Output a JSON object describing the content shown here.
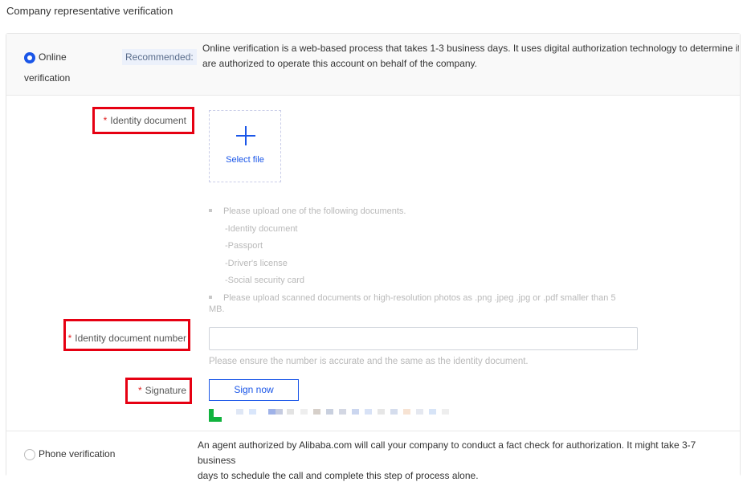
{
  "page": {
    "title": "Company representative verification"
  },
  "online": {
    "label_line1": "Online",
    "label_line2": "verification",
    "badge": "Recommended:",
    "desc_line1": "Online verification is a web-based process that takes 1-3 business days. It uses digital authorization technology to determine if you",
    "desc_line2": "are authorized to operate this account on behalf of the company."
  },
  "identity_doc": {
    "required_mark": "*",
    "label": "Identity document",
    "upload_label": "Select file",
    "hint_intro": "Please upload one of the following documents.",
    "doc_types": [
      "-Identity document",
      "-Passport",
      "-Driver's license",
      "-Social security card"
    ],
    "hint_format_line1": "Please upload scanned documents or high-resolution photos as .png .jpeg .jpg or .pdf smaller than 5",
    "hint_format_line2": "MB."
  },
  "id_number": {
    "required_mark": "*",
    "label": "Identity document number",
    "value": "",
    "hint": "Please ensure the number is accurate and the same as the identity document."
  },
  "signature": {
    "required_mark": "*",
    "label": "Signature",
    "button_label": "Sign now"
  },
  "phone": {
    "label": "Phone verification",
    "desc_line1": "An agent authorized by Alibaba.com will call your company to conduct a fact check for authorization. It might take 3-7 business",
    "desc_line2": "days to schedule the call and complete this step of process alone."
  },
  "colors": {
    "accent": "#1a56e8",
    "required": "#e02020",
    "highlight_frame": "#e60012",
    "hint_text": "#b9b9b9",
    "signature_logo": "#11b33e"
  }
}
